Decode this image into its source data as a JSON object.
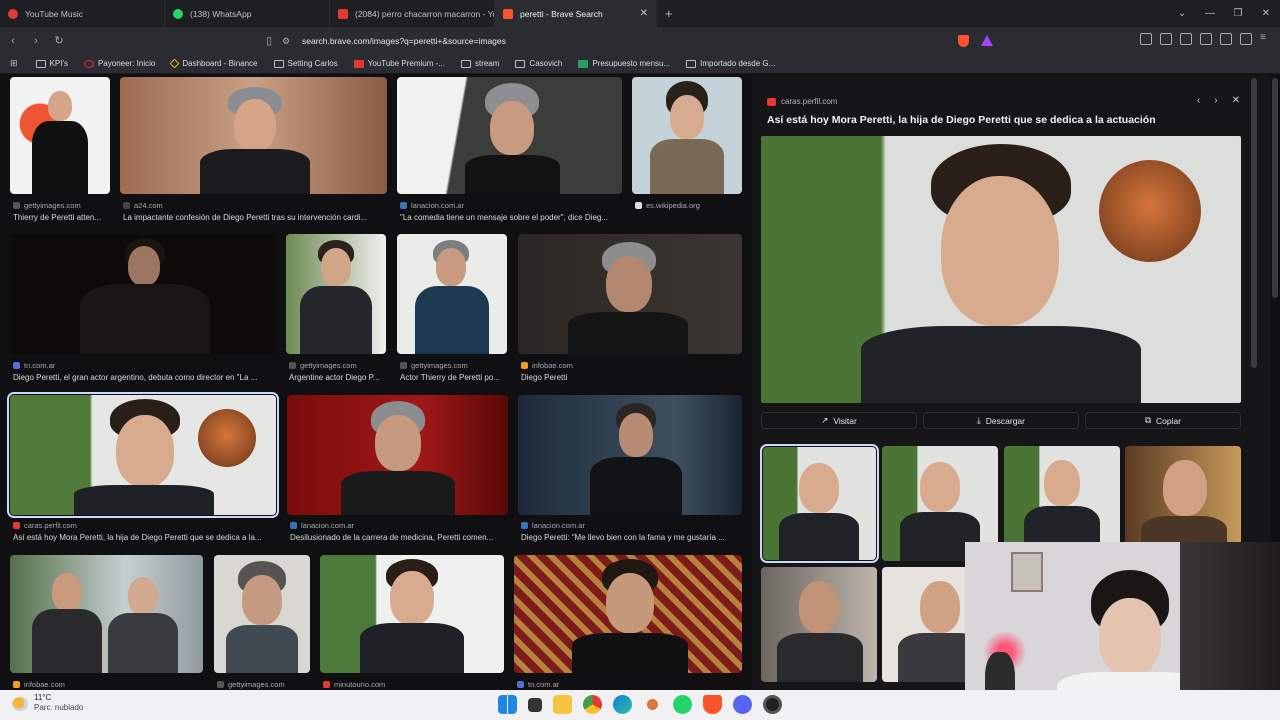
{
  "browser": {
    "tabs": [
      {
        "label": "YouTube Music",
        "color": "#e53935",
        "active": false
      },
      {
        "label": "(138) WhatsApp",
        "color": "#25d366",
        "active": false
      },
      {
        "label": "(2084) perro chacarron macarron - Yo",
        "color": "#e53935",
        "active": false
      },
      {
        "label": "peretti - Brave Search",
        "color": "#fb542b",
        "active": true
      }
    ],
    "new_tab": "+",
    "url": "search.brave.com/images?q=peretti+&source=images",
    "bookmarks": [
      "KPI's",
      "Payoneer: Inicio",
      "Dashboard - Binance",
      "Setting Carlos",
      "YouTube Premium -...",
      "stream",
      "Casovich",
      "Presupuesto mensu...",
      "Importado desde G..."
    ]
  },
  "results": [
    {
      "source": "gettyimages.com",
      "caption": "Thierry de Peretti atten..."
    },
    {
      "source": "a24.com",
      "caption": "La impactante confesión de Diego Peretti tras su intervención cardi..."
    },
    {
      "source": "lanacion.com.ar",
      "caption": "\"La comedia tiene un mensaje sobre el poder\", dice Dieg..."
    },
    {
      "source": "es.wikipedia.org",
      "caption": ""
    },
    {
      "source": "tn.com.ar",
      "caption": "Diego Peretti, el gran actor argentino, debuta como director en \"La ..."
    },
    {
      "source": "gettyimages.com",
      "caption": "Argentine actor Diego P..."
    },
    {
      "source": "gettyimages.com",
      "caption": "Actor Thierry de Peretti po..."
    },
    {
      "source": "infobae.com",
      "caption": "Diego Peretti"
    },
    {
      "source": "caras.perfil.com",
      "caption": "Así está hoy Mora Peretti, la hija de Diego Peretti que se dedica a la..."
    },
    {
      "source": "lanacion.com.ar",
      "caption": "Desilusionado de la carrera de medicina, Peretti comen..."
    },
    {
      "source": "lanacion.com.ar",
      "caption": "Diego Peretti: \"Me llevo bien con la fama y me gustaría ..."
    },
    {
      "source": "infobae.com",
      "caption": ""
    },
    {
      "source": "gettyimages.com",
      "caption": ""
    },
    {
      "source": "minutouno.com",
      "caption": ""
    },
    {
      "source": "tn.com.ar",
      "caption": ""
    }
  ],
  "panel": {
    "source": "caras.perfil.com",
    "title": "Así está hoy Mora Peretti, la hija de Diego Peretti que se dedica a la actuación",
    "visit": "Visitar",
    "download": "Descargar",
    "copy": "Copiar",
    "prev_icon": "‹",
    "next_icon": "›",
    "close_icon": "✕"
  },
  "taskbar": {
    "temp": "11°C",
    "weather": "Parc. nublado"
  },
  "colors": {
    "accent": "#fb542b",
    "selected_outline": "#cfd6ff"
  }
}
